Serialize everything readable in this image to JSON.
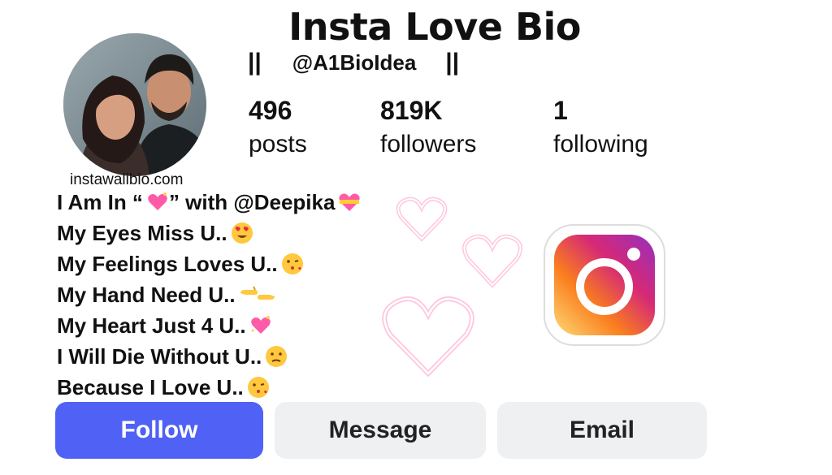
{
  "header": {
    "title": "Insta Love Bio",
    "bar_left": "||",
    "handle": "@A1BioIdea",
    "bar_right": "||"
  },
  "profile": {
    "site_label": "instawalibio.com"
  },
  "stats": [
    {
      "value": "496",
      "label": "posts"
    },
    {
      "value": "819K",
      "label": "followers"
    },
    {
      "value": "1",
      "label": "following"
    }
  ],
  "bio": {
    "line1_a": "I Am In “",
    "line1_b": "” with @Deepika ",
    "lines": [
      {
        "text": "My Eyes Miss U..",
        "emoji": "heart-eyes-icon"
      },
      {
        "text": "My Feelings Loves U..",
        "emoji": "kiss-face-icon"
      },
      {
        "text": "My Hand Need U..",
        "emoji": "hands-icon"
      },
      {
        "text": "My Heart Just 4 U..",
        "emoji": "sparkling-heart-icon"
      },
      {
        "text": "I Will Die Without U..",
        "emoji": "sad-face-icon"
      },
      {
        "text": "Because I Love U..",
        "emoji": "kiss-face-icon"
      }
    ]
  },
  "buttons": {
    "follow": "Follow",
    "message": "Message",
    "email": "Email"
  },
  "colors": {
    "follow_bg": "#4f62f5",
    "secondary_bg": "#eef0f2",
    "neon_pink": "#ff5fa8"
  }
}
